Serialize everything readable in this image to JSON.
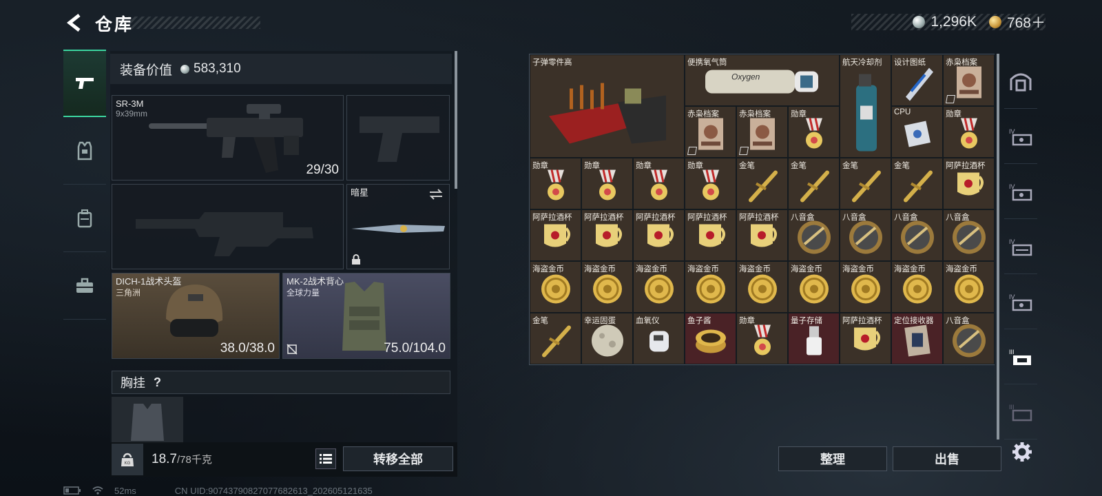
{
  "header": {
    "title": "仓库",
    "silver_amount": "1,296K",
    "gold_amount": "768＋"
  },
  "equip_value": {
    "label": "装备价值",
    "value": "583,310"
  },
  "loadout": {
    "primary": {
      "name": "SR-3M",
      "caliber": "9x39mm",
      "ammo": "29/30"
    },
    "melee": {
      "name": "暗星"
    },
    "helmet": {
      "name": "DICH-1战术头盔",
      "brand": "三角洲",
      "durability": "38.0/38.0"
    },
    "armor": {
      "name": "MK-2战术背心",
      "brand": "全球力量",
      "durability": "75.0/104.0"
    },
    "chest_rig": {
      "label": "胸挂",
      "help": "?"
    }
  },
  "weight": {
    "value": "18.7",
    "max": "/78千克"
  },
  "buttons": {
    "transfer_all": "转移全部",
    "sort": "整理",
    "sell": "出售"
  },
  "stash_items": [
    {
      "label": "子弹零件高",
      "icon": "ammo-parts-icon",
      "color": "brown"
    },
    {
      "label": "便携氧气筒",
      "icon": "oxygen-tank-icon",
      "color": "brown"
    },
    {
      "label": "航天冷却剂",
      "icon": "coolant-icon",
      "color": "brown"
    },
    {
      "label": "设计图纸",
      "icon": "blueprint-icon",
      "color": "brown"
    },
    {
      "label": "赤枭档案",
      "icon": "dossier-icon",
      "color": "brown"
    },
    {
      "label": "赤枭档案",
      "icon": "dossier-icon",
      "color": "brown"
    },
    {
      "label": "赤枭档案",
      "icon": "dossier-icon",
      "color": "brown"
    },
    {
      "label": "勋章",
      "icon": "medal-icon",
      "color": "brown"
    },
    {
      "label": "CPU",
      "icon": "cpu-icon",
      "color": "brown"
    },
    {
      "label": "勋章",
      "icon": "medal-icon",
      "color": "brown"
    },
    {
      "label": "勋章",
      "icon": "medal-icon",
      "color": "brown"
    },
    {
      "label": "勋章",
      "icon": "medal-icon",
      "color": "brown"
    },
    {
      "label": "勋章",
      "icon": "medal-icon",
      "color": "brown"
    },
    {
      "label": "勋章",
      "icon": "medal-icon",
      "color": "brown"
    },
    {
      "label": "金笔",
      "icon": "gold-pen-icon",
      "color": "brown"
    },
    {
      "label": "金笔",
      "icon": "gold-pen-icon",
      "color": "brown"
    },
    {
      "label": "金笔",
      "icon": "gold-pen-icon",
      "color": "brown"
    },
    {
      "label": "金笔",
      "icon": "gold-pen-icon",
      "color": "brown"
    },
    {
      "label": "阿萨拉酒杯",
      "icon": "goblet-icon",
      "color": "brown"
    },
    {
      "label": "阿萨拉酒杯",
      "icon": "goblet-icon",
      "color": "brown"
    },
    {
      "label": "阿萨拉酒杯",
      "icon": "goblet-icon",
      "color": "brown"
    },
    {
      "label": "阿萨拉酒杯",
      "icon": "goblet-icon",
      "color": "brown"
    },
    {
      "label": "阿萨拉酒杯",
      "icon": "goblet-icon",
      "color": "brown"
    },
    {
      "label": "阿萨拉酒杯",
      "icon": "goblet-icon",
      "color": "brown"
    },
    {
      "label": "八音盒",
      "icon": "music-box-icon",
      "color": "brown"
    },
    {
      "label": "八音盒",
      "icon": "music-box-icon",
      "color": "brown"
    },
    {
      "label": "八音盒",
      "icon": "music-box-icon",
      "color": "brown"
    },
    {
      "label": "八音盒",
      "icon": "music-box-icon",
      "color": "brown"
    },
    {
      "label": "海盗金币",
      "icon": "pirate-coin-icon",
      "color": "brown"
    },
    {
      "label": "海盗金币",
      "icon": "pirate-coin-icon",
      "color": "brown"
    },
    {
      "label": "海盗金币",
      "icon": "pirate-coin-icon",
      "color": "brown"
    },
    {
      "label": "海盗金币",
      "icon": "pirate-coin-icon",
      "color": "brown"
    },
    {
      "label": "海盗金币",
      "icon": "pirate-coin-icon",
      "color": "brown"
    },
    {
      "label": "海盗金币",
      "icon": "pirate-coin-icon",
      "color": "brown"
    },
    {
      "label": "海盗金币",
      "icon": "pirate-coin-icon",
      "color": "brown"
    },
    {
      "label": "海盗金币",
      "icon": "pirate-coin-icon",
      "color": "brown"
    },
    {
      "label": "海盗金币",
      "icon": "pirate-coin-icon",
      "color": "brown"
    },
    {
      "label": "金笔",
      "icon": "gold-pen-icon",
      "color": "brown"
    },
    {
      "label": "幸运固蛋",
      "icon": "lucky-egg-icon",
      "color": "brown"
    },
    {
      "label": "血氧仪",
      "icon": "oximeter-icon",
      "color": "brown"
    },
    {
      "label": "鱼子酱",
      "icon": "caviar-icon",
      "color": "red"
    },
    {
      "label": "勋章",
      "icon": "medal-icon",
      "color": "brown"
    },
    {
      "label": "量子存储",
      "icon": "quantum-storage-icon",
      "color": "red"
    },
    {
      "label": "阿萨拉酒杯",
      "icon": "goblet-icon",
      "color": "brown"
    },
    {
      "label": "定位接收器",
      "icon": "locator-icon",
      "color": "red"
    },
    {
      "label": "八音盒",
      "icon": "music-box-icon",
      "color": "brown"
    }
  ],
  "status": {
    "latency": "52ms",
    "uid": "CN UID:9074379082707768261​3_202605121635"
  }
}
